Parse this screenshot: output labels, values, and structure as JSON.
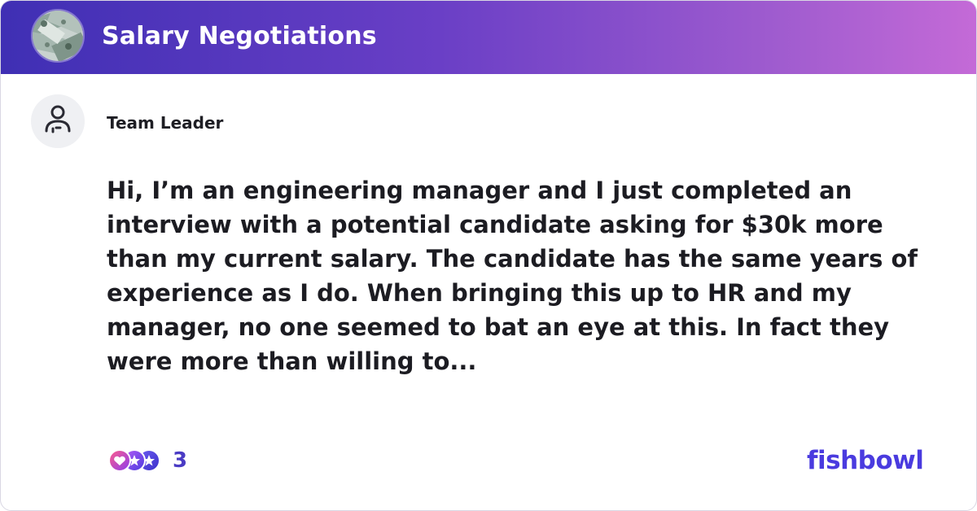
{
  "group": {
    "title": "Salary Negotiations",
    "avatar_icon": "money-bills-icon"
  },
  "author": {
    "name": "Team Leader",
    "avatar_icon": "person-icon"
  },
  "post": {
    "body": "Hi, I’m an engineering manager and I just completed an interview with a potential candidate asking for $30k more than my current salary. The candidate has the same years of experience as I do. When bringing this up to HR and my manager, no one seemed to bat an eye at this. In fact they were more than willing to..."
  },
  "reactions": {
    "count": "3",
    "icons": [
      "heart-reaction-icon",
      "star-reaction-icon",
      "star-reaction-icon"
    ]
  },
  "brand": {
    "logo_text": "fishbowl"
  },
  "colors": {
    "header_gradient_start": "#3f2fb4",
    "header_gradient_end": "#c46ad7",
    "brand": "#4a3bdf",
    "reaction_count": "#4a3bc4"
  }
}
